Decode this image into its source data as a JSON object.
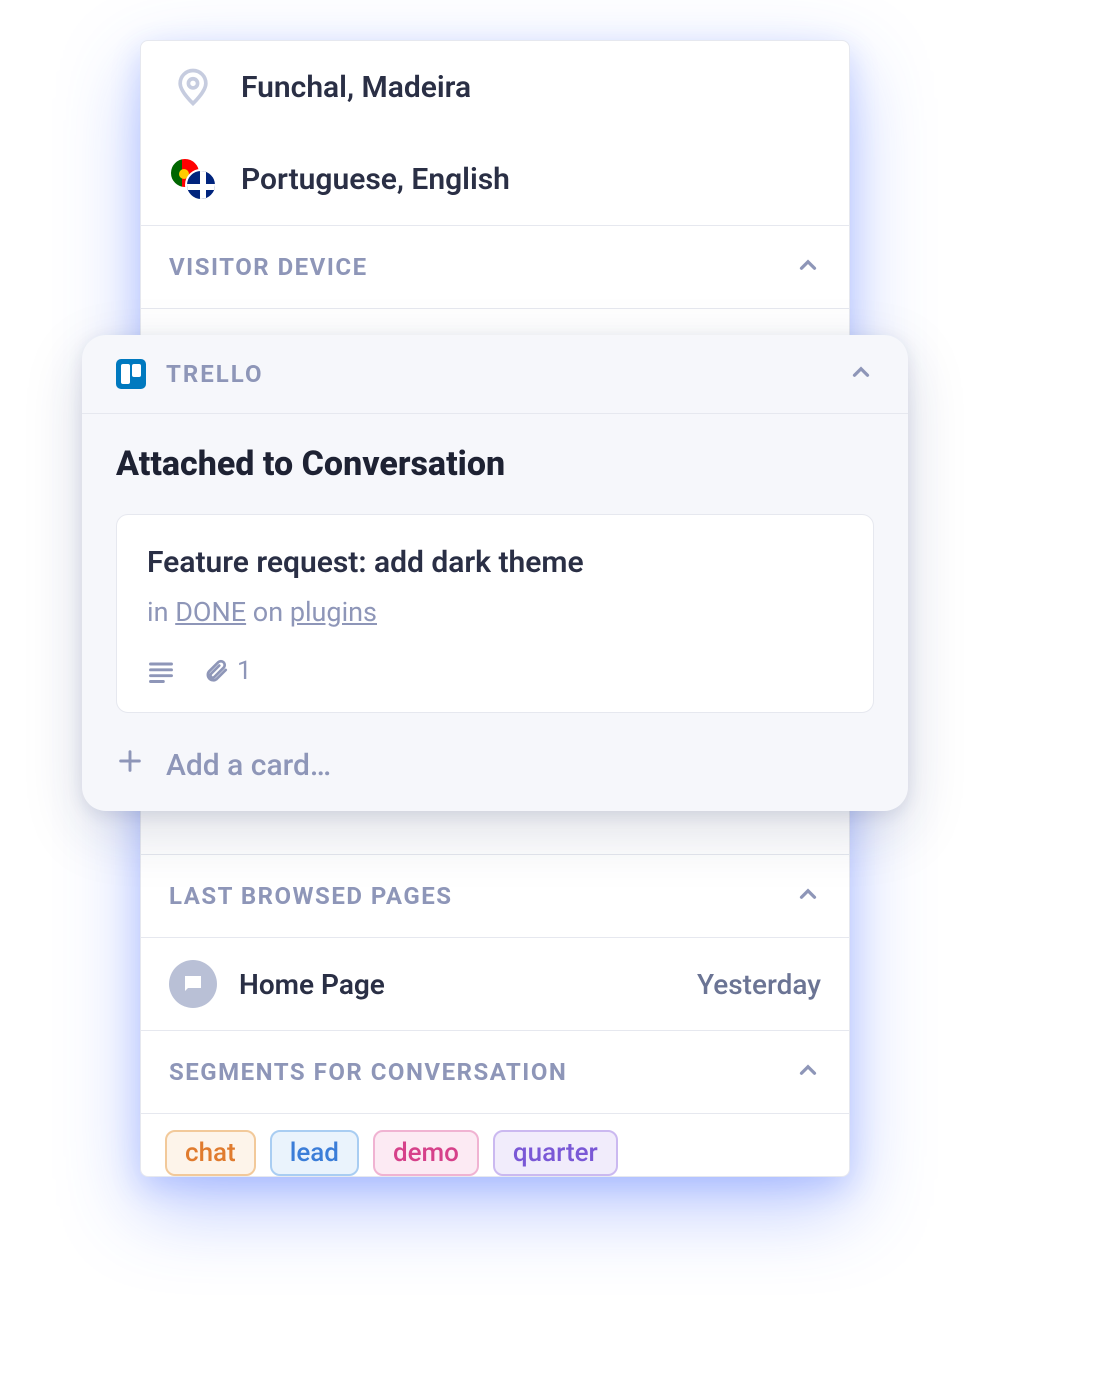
{
  "visitor": {
    "location": "Funchal, Madeira",
    "languages": "Portuguese, English"
  },
  "sections": {
    "device_title": "VISITOR DEVICE",
    "trello_title": "TRELLO",
    "last_pages_title": "LAST BROWSED PAGES",
    "segments_title": "SEGMENTS FOR CONVERSATION"
  },
  "trello": {
    "heading": "Attached to Conversation",
    "card": {
      "title": "Feature request: add dark theme",
      "in_word": "in",
      "list": "DONE",
      "on_word": "on",
      "board": "plugins",
      "attachment_count": "1"
    },
    "add_label": "Add a card…"
  },
  "last_pages": {
    "page": "Home Page",
    "time": "Yesterday"
  },
  "segments": {
    "chat": "chat",
    "lead": "lead",
    "demo": "demo",
    "quarter": "quarter"
  }
}
